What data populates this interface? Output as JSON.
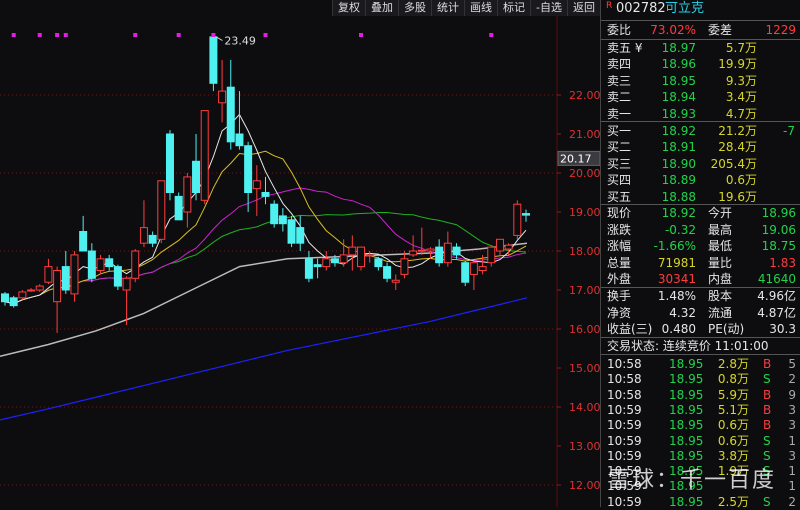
{
  "toolbar": [
    "复权",
    "叠加",
    "多股",
    "统计",
    "画线",
    "标记",
    "-自选",
    "返回"
  ],
  "stock": {
    "badge": "R",
    "code": "002782",
    "name": "可立克"
  },
  "weibi": {
    "label": "委比",
    "value": "73.02%",
    "diff_label": "委差",
    "diff": "1229"
  },
  "sell": [
    {
      "label": "卖五 ¥",
      "price": "18.97",
      "vol": "5.7万"
    },
    {
      "label": "卖四",
      "price": "18.96",
      "vol": "19.9万"
    },
    {
      "label": "卖三",
      "price": "18.95",
      "vol": "9.3万"
    },
    {
      "label": "卖二",
      "price": "18.94",
      "vol": "3.4万"
    },
    {
      "label": "卖一",
      "price": "18.93",
      "vol": "4.7万"
    }
  ],
  "buy": [
    {
      "label": "买一",
      "price": "18.92",
      "vol": "21.2万",
      "chg": "-7"
    },
    {
      "label": "买二",
      "price": "18.91",
      "vol": "28.4万",
      "chg": ""
    },
    {
      "label": "买三",
      "price": "18.90",
      "vol": "205.4万",
      "chg": ""
    },
    {
      "label": "买四",
      "price": "18.89",
      "vol": "0.6万",
      "chg": ""
    },
    {
      "label": "买五",
      "price": "18.88",
      "vol": "19.6万",
      "chg": ""
    }
  ],
  "quote": [
    {
      "l1": "现价",
      "v1": "18.92",
      "c1": "g",
      "l2": "今开",
      "v2": "18.96",
      "c2": "g"
    },
    {
      "l1": "涨跌",
      "v1": "-0.32",
      "c1": "g",
      "l2": "最高",
      "v2": "19.06",
      "c2": "g"
    },
    {
      "l1": "涨幅",
      "v1": "-1.66%",
      "c1": "g",
      "l2": "最低",
      "v2": "18.75",
      "c2": "g"
    },
    {
      "l1": "总量",
      "v1": "71981",
      "c1": "y",
      "l2": "量比",
      "v2": "1.83",
      "c2": "r"
    },
    {
      "l1": "外盘",
      "v1": "30341",
      "c1": "r",
      "l2": "内盘",
      "v2": "41640",
      "c2": "g"
    }
  ],
  "fund": [
    {
      "l1": "换手",
      "v1": "1.48%",
      "l2": "股本",
      "v2": "4.96亿"
    },
    {
      "l1": "净资",
      "v1": "4.32",
      "l2": "流通",
      "v2": "4.87亿"
    },
    {
      "l1": "收益(三)",
      "v1": "0.480",
      "l2": "PE(动)",
      "v2": "30.3"
    }
  ],
  "status": "交易状态: 连续竞价 11:01:00",
  "trades": [
    {
      "t": "10:58",
      "p": "18.95",
      "v": "2.8万",
      "s": "B",
      "n": "5"
    },
    {
      "t": "10:58",
      "p": "18.95",
      "v": "0.8万",
      "s": "S",
      "n": "2"
    },
    {
      "t": "10:58",
      "p": "18.95",
      "v": "5.9万",
      "s": "B",
      "n": "9"
    },
    {
      "t": "10:59",
      "p": "18.95",
      "v": "5.1万",
      "s": "B",
      "n": "3"
    },
    {
      "t": "10:59",
      "p": "18.95",
      "v": "0.6万",
      "s": "B",
      "n": "3"
    },
    {
      "t": "10:59",
      "p": "18.95",
      "v": "0.6万",
      "s": "S",
      "n": "1"
    },
    {
      "t": "10:59",
      "p": "18.95",
      "v": "3.8万",
      "s": "S",
      "n": "3"
    },
    {
      "t": "10:59",
      "p": "18.95",
      "v": "1.9万",
      "s": "S",
      "n": "1"
    },
    {
      "t": "10:59",
      "p": "18.95",
      "v": "",
      "s": "",
      "n": "1"
    },
    {
      "t": "10:59",
      "p": "18.95",
      "v": "2.5万",
      "s": "S",
      "n": "2"
    }
  ],
  "watermark": "雪球：千一百度",
  "chart_data": {
    "type": "candlestick",
    "y_ticks": [
      "22.00",
      "21.00",
      "20.00",
      "19.00",
      "18.00",
      "17.00",
      "16.00",
      "15.00",
      "14.00",
      "13.00",
      "12.00"
    ],
    "ylim": [
      12,
      22
    ],
    "current_marker": "20.17",
    "high_label": "23.49",
    "colors": {
      "up": "#ff3c3c",
      "down": "#4ef0f0",
      "ma5": "#e8e8e8",
      "ma10": "#d8c020",
      "ma20": "#d020d0",
      "ma30": "#20b020",
      "ma60": "#bbbbbb",
      "ma250": "#2020ff"
    },
    "ohlc": [
      [
        16.9,
        16.95,
        16.6,
        16.7
      ],
      [
        16.8,
        16.85,
        16.55,
        16.6
      ],
      [
        16.8,
        17.0,
        16.75,
        16.95
      ],
      [
        17.0,
        17.05,
        16.95,
        17.0
      ],
      [
        17.0,
        17.15,
        16.95,
        17.1
      ],
      [
        17.2,
        17.8,
        17.15,
        17.6
      ],
      [
        16.7,
        17.6,
        15.9,
        17.5
      ],
      [
        17.6,
        18.0,
        16.9,
        17.0
      ],
      [
        16.9,
        18.0,
        16.7,
        17.9
      ],
      [
        18.5,
        18.9,
        18.0,
        18.0
      ],
      [
        18.0,
        18.2,
        17.2,
        17.3
      ],
      [
        17.5,
        17.9,
        17.4,
        17.8
      ],
      [
        17.8,
        17.9,
        17.5,
        17.6
      ],
      [
        17.6,
        17.65,
        17.0,
        17.1
      ],
      [
        17.0,
        17.35,
        16.1,
        17.3
      ],
      [
        17.3,
        18.05,
        17.2,
        18.0
      ],
      [
        18.2,
        19.3,
        18.1,
        18.6
      ],
      [
        18.4,
        18.5,
        18.1,
        18.2
      ],
      [
        18.3,
        19.8,
        18.2,
        19.8
      ],
      [
        21.0,
        21.1,
        19.3,
        19.5
      ],
      [
        19.4,
        19.5,
        18.8,
        18.8
      ],
      [
        19.0,
        20.0,
        18.6,
        19.9
      ],
      [
        20.3,
        21.0,
        19.3,
        19.5
      ],
      [
        19.3,
        21.6,
        19.2,
        21.6
      ],
      [
        23.49,
        23.5,
        22.1,
        22.3
      ],
      [
        21.8,
        22.9,
        21.3,
        22.1
      ],
      [
        22.2,
        22.9,
        20.6,
        20.8
      ],
      [
        21.0,
        22.1,
        20.6,
        20.7
      ],
      [
        20.7,
        20.8,
        19.0,
        19.5
      ],
      [
        19.6,
        20.2,
        18.9,
        19.8
      ],
      [
        19.5,
        19.9,
        19.2,
        19.4
      ],
      [
        19.2,
        19.3,
        18.6,
        18.7
      ],
      [
        18.9,
        19.1,
        18.5,
        18.7
      ],
      [
        18.8,
        18.9,
        18.1,
        18.2
      ],
      [
        18.6,
        18.9,
        18.0,
        18.2
      ],
      [
        17.8,
        18.0,
        17.2,
        17.3
      ],
      [
        17.65,
        17.8,
        17.3,
        17.6
      ],
      [
        17.6,
        18.0,
        17.5,
        17.8
      ],
      [
        17.8,
        17.9,
        17.6,
        17.7
      ],
      [
        17.7,
        18.3,
        17.6,
        17.9
      ],
      [
        17.9,
        18.4,
        17.5,
        18.1
      ],
      [
        17.6,
        18.1,
        17.5,
        18.1
      ],
      [
        17.9,
        18.0,
        17.7,
        17.9
      ],
      [
        17.8,
        17.85,
        17.5,
        17.6
      ],
      [
        17.6,
        17.7,
        17.2,
        17.3
      ],
      [
        17.2,
        17.4,
        17.0,
        17.25
      ],
      [
        17.4,
        18.0,
        17.3,
        17.8
      ],
      [
        17.9,
        18.4,
        17.85,
        18.0
      ],
      [
        18.0,
        18.6,
        17.9,
        18.02
      ],
      [
        18.0,
        18.1,
        17.8,
        18.05
      ],
      [
        18.1,
        18.3,
        17.6,
        17.7
      ],
      [
        17.7,
        18.5,
        17.6,
        18.2
      ],
      [
        18.1,
        18.2,
        17.8,
        17.9
      ],
      [
        17.7,
        17.75,
        17.1,
        17.2
      ],
      [
        17.4,
        17.7,
        17.0,
        17.7
      ],
      [
        17.5,
        17.9,
        17.4,
        17.6
      ],
      [
        17.7,
        18.1,
        17.6,
        18.1
      ],
      [
        18.0,
        18.3,
        17.9,
        18.3
      ],
      [
        18.05,
        18.2,
        17.9,
        18.15
      ],
      [
        18.4,
        19.3,
        18.3,
        19.2
      ],
      [
        18.96,
        19.06,
        18.75,
        18.92
      ]
    ],
    "ma60": [
      15.3,
      15.6,
      15.95,
      16.4,
      17.0,
      17.6,
      17.8,
      17.85,
      17.9,
      17.95,
      18.05,
      18.2
    ],
    "ma250": [
      13.67,
      13.95,
      14.25,
      14.55,
      14.85,
      15.15,
      15.45,
      15.7,
      15.95,
      16.2,
      16.5,
      16.8
    ],
    "event_markers": [
      1,
      4,
      6,
      7,
      15,
      20,
      24,
      30,
      41,
      56
    ]
  }
}
